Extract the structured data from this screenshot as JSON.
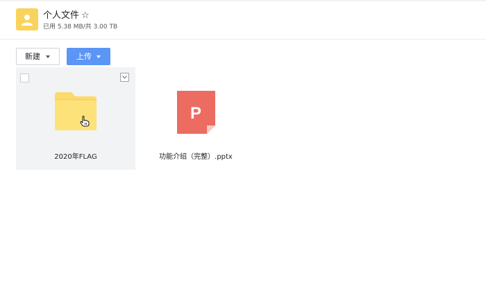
{
  "space": {
    "title": "个人文件",
    "usage": "已用 5.38 MB/共 3.00 TB",
    "avatar_icon": "user-icon",
    "star_icon": "star-outline-icon"
  },
  "toolbar": {
    "new_label": "新建",
    "upload_label": "上传"
  },
  "files": [
    {
      "name": "2020年FLAG",
      "type": "folder",
      "icon": "folder-icon",
      "state": "hover"
    },
    {
      "name": "功能介绍（完整）.pptx",
      "type": "pptx",
      "icon": "powerpoint-file-icon",
      "letter": "P"
    }
  ],
  "colors": {
    "accent": "#5b95f5",
    "folder": "#fbdb6d",
    "ppt": "#ec6c61",
    "avatar": "#f9d45c"
  }
}
